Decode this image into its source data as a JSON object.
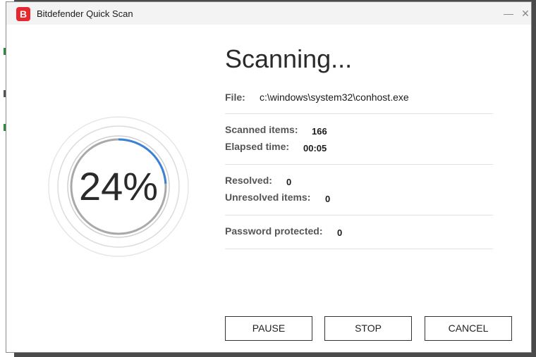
{
  "window": {
    "title": "Bitdefender Quick Scan",
    "logo_letter": "B",
    "minimize_glyph": "—",
    "close_glyph": "✕",
    "accent_color": "#e8262d"
  },
  "progress": {
    "percent_label": "24%",
    "fraction": 0.24,
    "arc_color": "#3b82d6"
  },
  "scan": {
    "heading": "Scanning...",
    "file_label": "File:",
    "file_value": "c:\\windows\\system32\\conhost.exe",
    "scanned_label": "Scanned items:",
    "scanned_value": "166",
    "elapsed_label": "Elapsed time:",
    "elapsed_value": "00:05",
    "resolved_label": "Resolved:",
    "resolved_value": "0",
    "unresolved_label": "Unresolved items:",
    "unresolved_value": "0",
    "password_label": "Password protected:",
    "password_value": "0"
  },
  "buttons": {
    "pause": "PAUSE",
    "stop": "STOP",
    "cancel": "CANCEL"
  }
}
